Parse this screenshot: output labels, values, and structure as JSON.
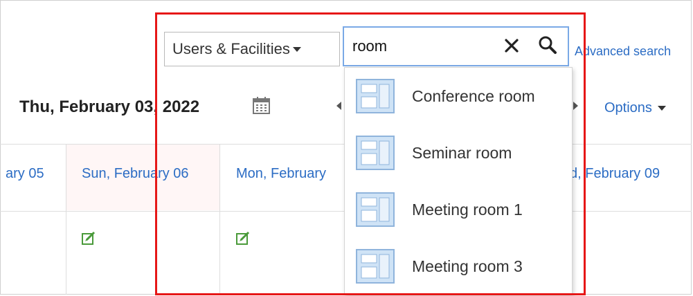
{
  "search": {
    "scope_label": "Users & Facilities",
    "query": "room",
    "advanced_link": "Advanced search"
  },
  "header": {
    "date_title": "Thu, February 03, 2022",
    "options_label": "Options"
  },
  "grid": {
    "day_headers": [
      "ary 05",
      "Sun, February 06",
      "Mon, February",
      "d, February 09"
    ]
  },
  "dropdown": {
    "items": [
      {
        "label": "Conference room"
      },
      {
        "label": "Seminar room"
      },
      {
        "label": "Meeting room 1"
      },
      {
        "label": "Meeting room 3"
      }
    ]
  },
  "colors": {
    "highlight": "#e61717",
    "link": "#2b6cc4",
    "focus_border": "#7aa9e6"
  },
  "icons": [
    "clear-icon",
    "search-icon",
    "calendar-icon",
    "add-schedule-icon",
    "facility-icon"
  ]
}
